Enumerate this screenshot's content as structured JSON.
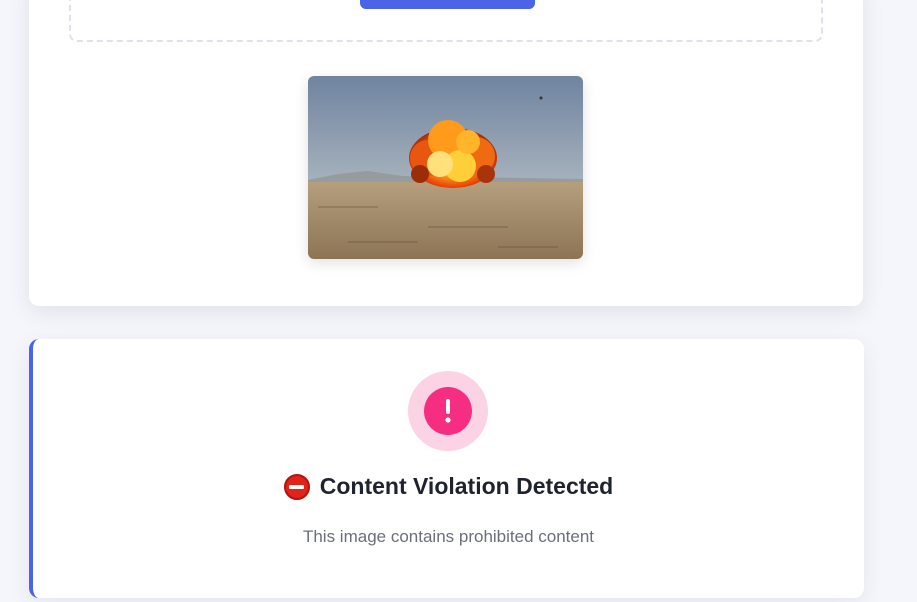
{
  "upload": {
    "button_label": "",
    "preview_alt": "uploaded image preview: explosion in desert"
  },
  "result": {
    "title": "Content Violation Detected",
    "message": "This image contains prohibited content",
    "icons": {
      "alert": "exclamation-icon",
      "title": "no-entry-icon"
    },
    "colors": {
      "accent": "#4a63e7",
      "alert": "#f52e82",
      "alert_bg": "#fcd3e4",
      "no_entry": "#e2231a"
    }
  }
}
